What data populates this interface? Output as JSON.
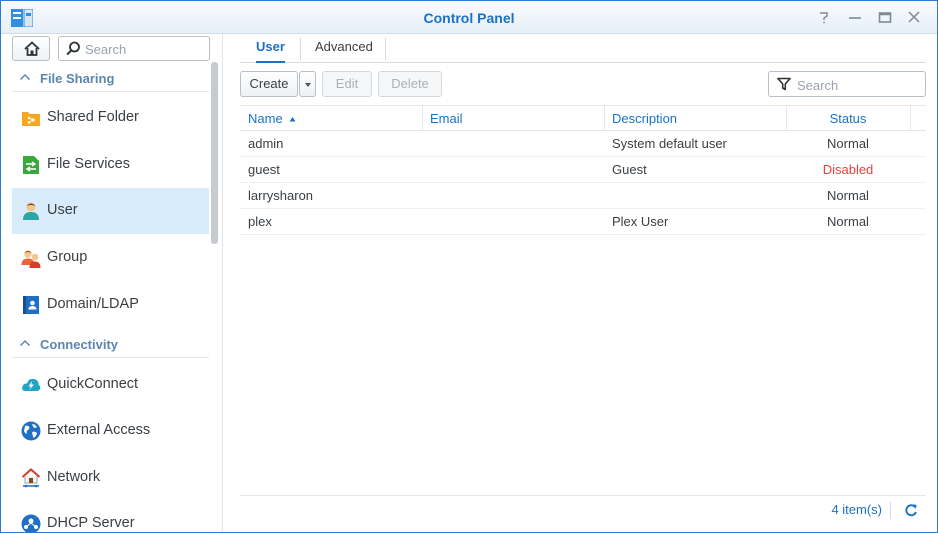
{
  "window": {
    "title": "Control Panel"
  },
  "sidebar": {
    "search_placeholder": "Search",
    "sections": [
      {
        "label": "File Sharing"
      },
      {
        "label": "Connectivity"
      }
    ],
    "items": [
      {
        "label": "Shared Folder",
        "icon": "shared-folder-icon"
      },
      {
        "label": "File Services",
        "icon": "file-services-icon"
      },
      {
        "label": "User",
        "icon": "user-icon",
        "selected": true
      },
      {
        "label": "Group",
        "icon": "group-icon"
      },
      {
        "label": "Domain/LDAP",
        "icon": "domain-ldap-icon"
      },
      {
        "label": "QuickConnect",
        "icon": "quickconnect-icon"
      },
      {
        "label": "External Access",
        "icon": "external-access-icon"
      },
      {
        "label": "Network",
        "icon": "network-icon"
      },
      {
        "label": "DHCP Server",
        "icon": "dhcp-server-icon"
      }
    ]
  },
  "tabs": [
    {
      "label": "User",
      "active": true
    },
    {
      "label": "Advanced",
      "active": false
    }
  ],
  "toolbar": {
    "create_label": "Create",
    "edit_label": "Edit",
    "delete_label": "Delete",
    "search_placeholder": "Search"
  },
  "grid": {
    "columns": [
      {
        "label": "Name",
        "sort": "ascending"
      },
      {
        "label": "Email"
      },
      {
        "label": "Description"
      },
      {
        "label": "Status"
      }
    ],
    "rows": [
      {
        "name": "admin",
        "email": "",
        "description": "System default user",
        "status": "Normal"
      },
      {
        "name": "guest",
        "email": "",
        "description": "Guest",
        "status": "Disabled"
      },
      {
        "name": "larrysharon",
        "email": "",
        "description": "",
        "status": "Normal"
      },
      {
        "name": "plex",
        "email": "",
        "description": "Plex User",
        "status": "Normal"
      }
    ]
  },
  "footer": {
    "count_label": "4 item(s)"
  },
  "colors": {
    "accent": "#1b72c6",
    "selected_bg": "#d8ebfa",
    "status_disabled": "#e8403a",
    "section_header": "#5b86b0"
  }
}
